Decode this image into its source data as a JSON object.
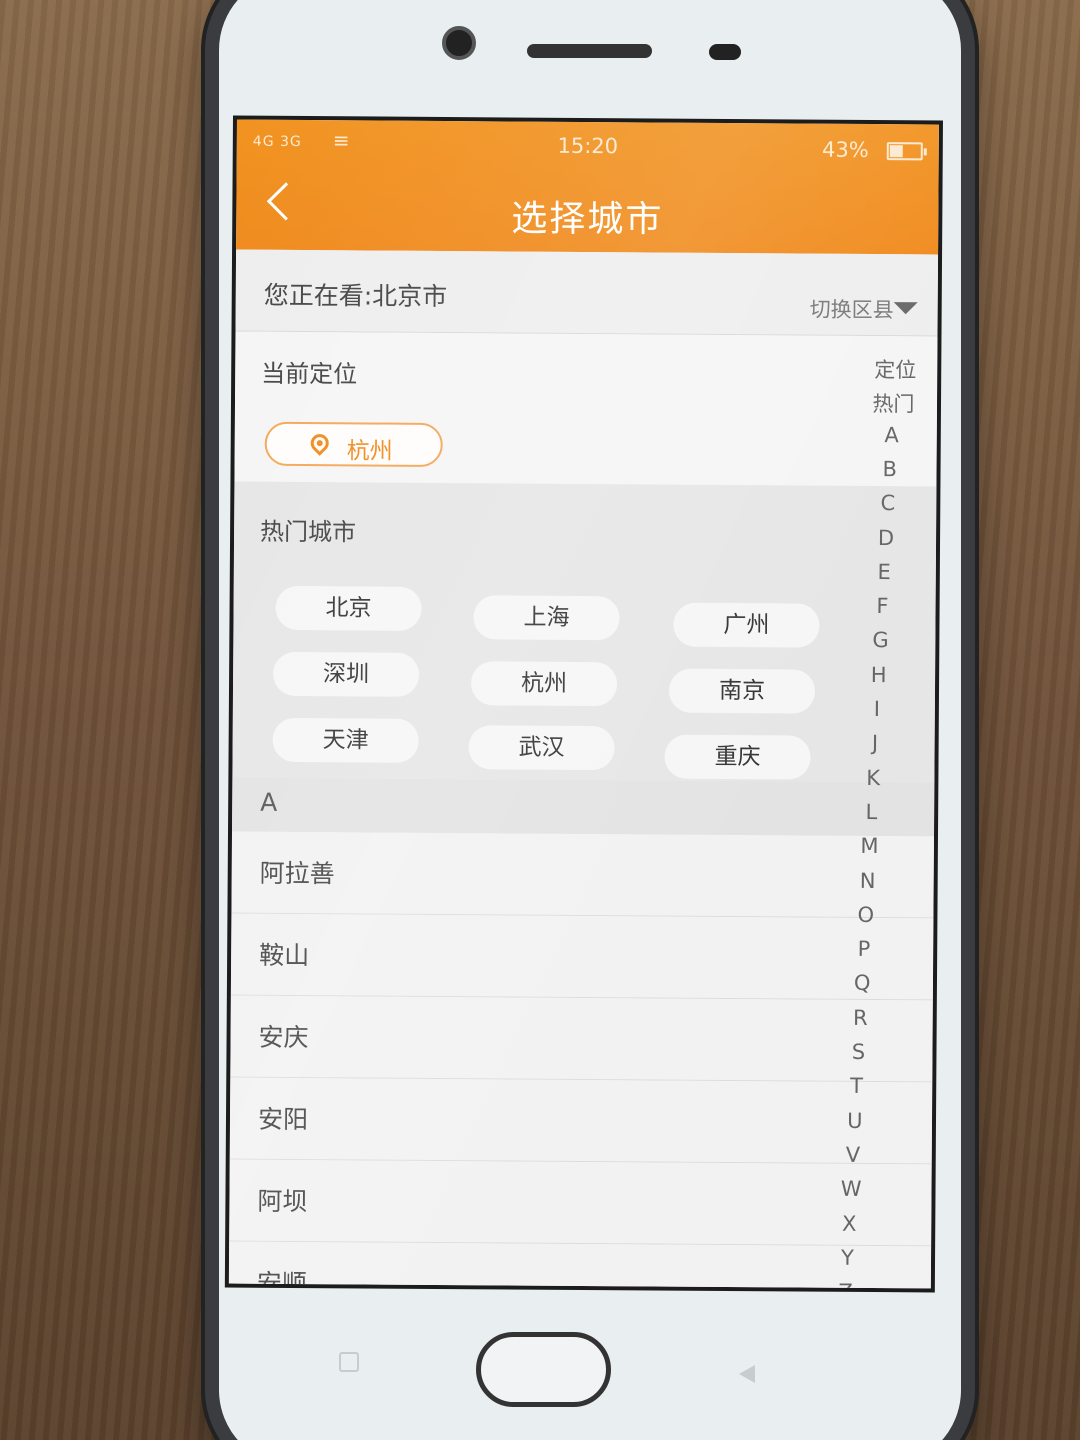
{
  "status_bar": {
    "signal": "4G 3G",
    "time": "15:20",
    "battery": "43%"
  },
  "header": {
    "title": "选择城市"
  },
  "viewing": {
    "label": "您正在看:北京市",
    "switch_label": "切换区县"
  },
  "current_location": {
    "label": "当前定位",
    "city": "杭州"
  },
  "hot_cities": {
    "label": "热门城市",
    "items": [
      "北京",
      "上海",
      "广州",
      "深圳",
      "杭州",
      "南京",
      "天津",
      "武汉",
      "重庆"
    ]
  },
  "city_list": {
    "letter": "A",
    "items": [
      "阿拉善",
      "鞍山",
      "安庆",
      "安阳",
      "阿坝",
      "安顺"
    ]
  },
  "index_bar": [
    "定位",
    "热门",
    "A",
    "B",
    "C",
    "D",
    "E",
    "F",
    "G",
    "H",
    "I",
    "J",
    "K",
    "L",
    "M",
    "N",
    "O",
    "P",
    "Q",
    "R",
    "S",
    "T",
    "U",
    "V",
    "W",
    "X",
    "Y",
    "Z"
  ],
  "colors": {
    "accent": "#f08a1c",
    "chip_border": "#f3a756"
  }
}
